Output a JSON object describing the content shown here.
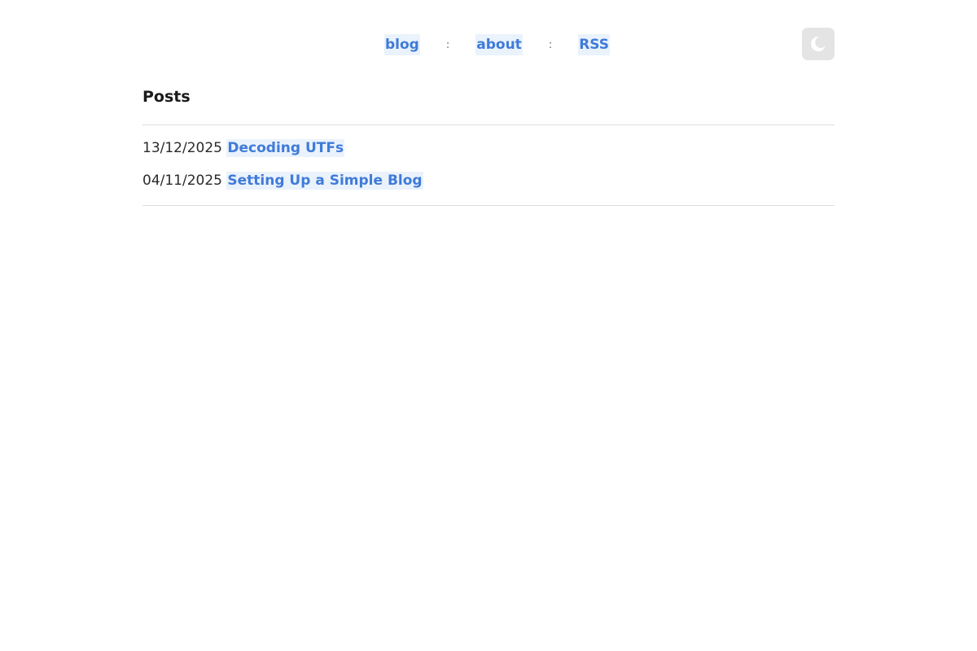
{
  "nav": {
    "links": [
      {
        "label": "blog"
      },
      {
        "label": "about"
      },
      {
        "label": "RSS"
      }
    ],
    "separator": ":",
    "theme_toggle_icon": "moon-icon"
  },
  "posts": {
    "heading": "Posts",
    "items": [
      {
        "date": "13/12/2025",
        "title": "Decoding UTFs"
      },
      {
        "date": "04/11/2025",
        "title": "Setting Up a Simple Blog"
      }
    ]
  },
  "colors": {
    "link": "#3f7bd9",
    "link_highlight": "#eaf2fc",
    "toggle_background": "#e4e4e4",
    "divider": "#dddddd"
  }
}
